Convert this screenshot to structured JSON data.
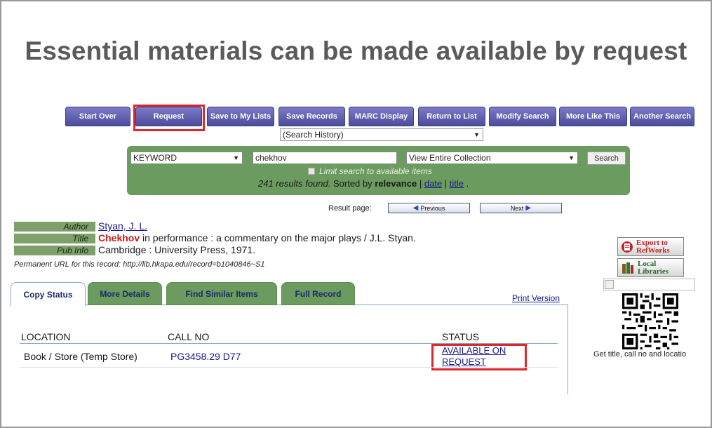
{
  "slide": {
    "title": "Essential materials can be made available by request"
  },
  "toolbar": {
    "buttons": [
      "Start Over",
      "Request",
      "Save to My Lists",
      "Save Records",
      "MARC Display",
      "Return to List",
      "Modify Search",
      "More Like This",
      "Another Search"
    ]
  },
  "history_select": {
    "value": "(Search History)"
  },
  "search": {
    "type_value": "KEYWORD",
    "query_value": "chekhov",
    "scope_value": "View Entire Collection",
    "search_label": "Search",
    "limit_label": "Limit search to available items",
    "results_count_text": "241 results found.",
    "sorted_by_text": " Sorted by ",
    "sort_relevance": "relevance",
    "sep1": " | ",
    "sort_date": "date",
    "sep2": " | ",
    "sort_title": "title",
    "sort_end": " ."
  },
  "result_page": {
    "label": "Result page:",
    "previous": "Previous",
    "next": "Next"
  },
  "bib": {
    "author_label": "Author",
    "author_value": "Styan, J. L.",
    "title_label": "Title",
    "title_highlight": "Chekhov",
    "title_rest": " in performance : a commentary on the major plays / J.L. Styan.",
    "pub_label": "Pub Info",
    "pub_value": "Cambridge : University Press, 1971.",
    "permanent_url": "Permanent URL for this record: http://lib.hkapa.edu/record=b1040846~S1"
  },
  "tabs": [
    "Copy Status",
    "More Details",
    "Find Similar Items",
    "Full Record"
  ],
  "print_version": "Print Version",
  "holdings": {
    "headers": [
      "LOCATION",
      "CALL NO",
      "STATUS"
    ],
    "rows": [
      {
        "location": "Book / Store (Temp Store)",
        "call_no": "PG3458.29 D77",
        "status": "AVAILABLE ON REQUEST"
      }
    ]
  },
  "side": {
    "refworks_line1": "Export to",
    "refworks_line2": "RefWorks",
    "local_line1": "Local",
    "local_line2": "Libraries",
    "qr_caption": "Get title, call no and locatio"
  },
  "colors": {
    "toolbar": "#5c5cae",
    "panel_green": "#6b9b5e",
    "highlight_red": "#e0262b",
    "link_blue": "#1a1a8a"
  }
}
